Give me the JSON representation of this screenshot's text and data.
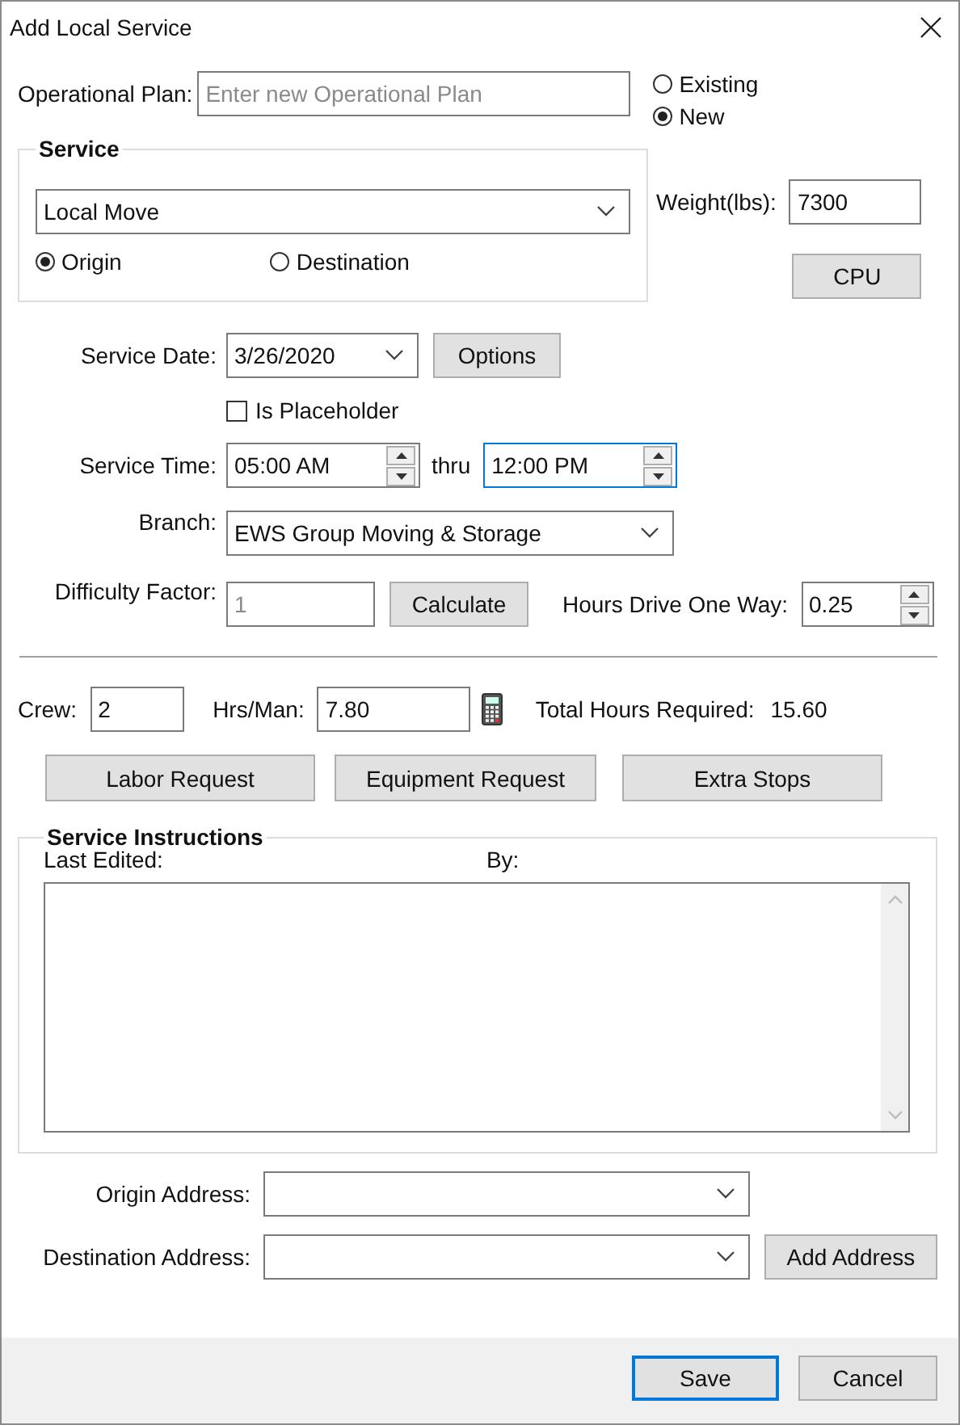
{
  "window": {
    "title": "Add Local Service"
  },
  "operational_plan": {
    "label": "Operational Plan:",
    "placeholder": "Enter new Operational Plan"
  },
  "plan_mode": [
    {
      "label": "Existing",
      "selected": false
    },
    {
      "label": "New",
      "selected": true
    }
  ],
  "service": {
    "legend": "Service",
    "value": "Local Move",
    "location": [
      {
        "label": "Origin",
        "selected": true
      },
      {
        "label": "Destination",
        "selected": false
      }
    ]
  },
  "weight": {
    "label": "Weight(lbs):",
    "value": "7300"
  },
  "cpu_button": "CPU",
  "service_date": {
    "label": "Service Date:",
    "value": "3/26/2020"
  },
  "options_button": "Options",
  "is_placeholder": {
    "label": "Is Placeholder",
    "checked": false
  },
  "service_time": {
    "label": "Service Time:",
    "separator": "thru",
    "start": {
      "value": "05:00 AM",
      "focused": false
    },
    "end": {
      "value": "12:00 PM",
      "focused": true
    }
  },
  "branch": {
    "label": "Branch:",
    "value": "EWS Group Moving & Storage"
  },
  "difficulty": {
    "label": "Difficulty Factor:",
    "value": "1",
    "disabled": true
  },
  "calculate_button": "Calculate",
  "hours_drive": {
    "label": "Hours Drive One Way:",
    "value": "0.25"
  },
  "crew": {
    "label": "Crew:",
    "value": "2"
  },
  "hrs_per_man": {
    "label": "Hrs/Man:",
    "value": "7.80"
  },
  "total_hours": {
    "label": "Total Hours Required:",
    "value": "15.60"
  },
  "request_buttons": [
    "Labor Request",
    "Equipment Request",
    "Extra Stops"
  ],
  "service_instructions": {
    "legend": "Service Instructions",
    "last_edited_label": "Last Edited:",
    "by_label": "By:"
  },
  "origin_address": {
    "label": "Origin Address:"
  },
  "destination_address": {
    "label": "Destination Address:"
  },
  "add_address_button": "Add Address",
  "footer_buttons": [
    {
      "label": "Save",
      "default": true
    },
    {
      "label": "Cancel",
      "default": false
    }
  ]
}
